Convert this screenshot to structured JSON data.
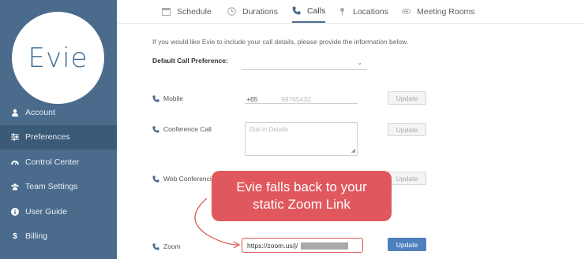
{
  "brand": {
    "logo_text": "Evie"
  },
  "sidebar": {
    "items": [
      {
        "label": "Account",
        "icon": "user-icon",
        "active": false
      },
      {
        "label": "Preferences",
        "icon": "sliders-icon",
        "active": true
      },
      {
        "label": "Control Center",
        "icon": "gauge-icon",
        "active": false
      },
      {
        "label": "Team Settings",
        "icon": "team-icon",
        "active": false
      },
      {
        "label": "User Guide",
        "icon": "info-icon",
        "active": false
      },
      {
        "label": "Billing",
        "icon": "dollar-icon",
        "active": false
      }
    ]
  },
  "tabs": [
    {
      "label": "Schedule",
      "icon": "calendar-icon"
    },
    {
      "label": "Durations",
      "icon": "clock-icon"
    },
    {
      "label": "Calls",
      "icon": "phone-icon",
      "active": true
    },
    {
      "label": "Locations",
      "icon": "map-pin-icon"
    },
    {
      "label": "Meeting Rooms",
      "icon": "meeting-room-icon"
    }
  ],
  "content": {
    "intro": "If you would like Evie to include your call details, please provide the information below.",
    "default_pref_label": "Default Call Preference:",
    "mobile_label": "Mobile",
    "mobile_prefix": "+65",
    "mobile_placeholder": "98765432",
    "conference_label": "Conference Call",
    "conference_placeholder": "Dial in Details",
    "web_label": "Web Conferencing",
    "zoom_label": "Zoom",
    "zoom_value": "https://zoom.us/j/",
    "update_label": "Update"
  },
  "callout": {
    "line1": "Evie falls back to your",
    "line2": "static Zoom Link"
  },
  "colors": {
    "sidebar": "#4a6b8c",
    "sidebar_active": "#3b5a78",
    "callout": "#e0585e",
    "primary_button": "#4f80be"
  }
}
